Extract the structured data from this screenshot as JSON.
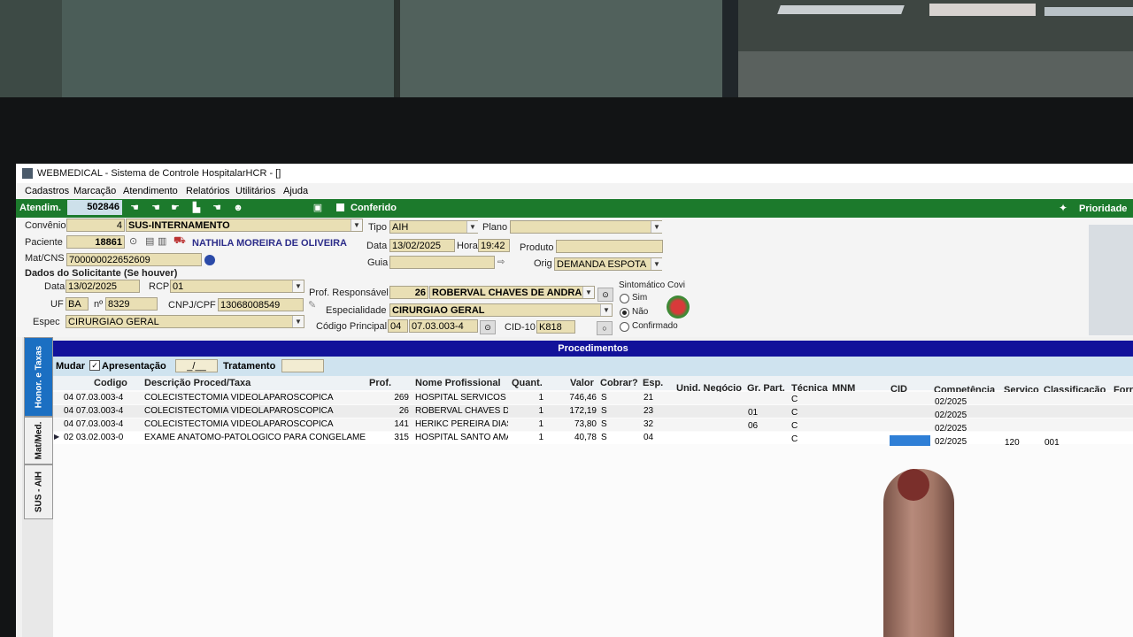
{
  "window": {
    "title": "WEBMEDICAL - Sistema de Controle HospitalarHCR - []"
  },
  "menu": [
    "Cadastros",
    "Marcação",
    "Atendimento",
    "Relatórios",
    "Utilitários",
    "Ajuda"
  ],
  "toolbar": {
    "atendimento_label": "Atendim.",
    "atendimento_value": "502846",
    "conferido_label": "Conferido",
    "prioridade_label": "Prioridade"
  },
  "form": {
    "convenio_label": "Convênio",
    "convenio_code": "4",
    "convenio_name": "SUS-INTERNAMENTO",
    "tipo_label": "Tipo",
    "tipo_value": "AIH",
    "plano_label": "Plano",
    "plano_value": "",
    "paciente_label": "Paciente",
    "paciente_code": "18861",
    "paciente_name": "NATHILA MOREIRA DE OLIVEIRA",
    "data_label": "Data",
    "data_value": "13/02/2025",
    "hora_label": "Hora",
    "hora_value": "19:42",
    "produto_label": "Produto",
    "produto_value": "",
    "matcns_label": "Mat/CNS",
    "matcns_value": "700000022652609",
    "guia_label": "Guia",
    "guia_value": "",
    "orig_label": "Orig",
    "orig_value": "DEMANDA ESPOTA",
    "solicitante_header": "Dados do Solicitante (Se houver)",
    "sol_data_label": "Data",
    "sol_data_value": "13/02/2025",
    "rcp_label": "RCP",
    "rcp_value": "01",
    "uf_label": "UF",
    "uf_value": "BA",
    "numero_label": "nº",
    "numero_value": "8329",
    "cnpj_label": "CNPJ/CPF",
    "cnpj_value": "13068008549",
    "espec_label": "Espec",
    "espec_value": "CIRURGIAO GERAL",
    "prof_resp_label": "Prof. Responsável",
    "prof_resp_code": "26",
    "prof_resp_name": "ROBERVAL CHAVES DE ANDRA",
    "especialidade_label": "Especialidade",
    "especialidade_value": "CIRURGIAO GERAL",
    "cod_principal_label": "Código Principal",
    "cod_principal_group": "04",
    "cod_principal_value": "07.03.003-4",
    "cid10_label": "CID-10",
    "cid10_value": "K818",
    "covid_label": "Sintomático Covi",
    "covid_options": [
      "Sim",
      "Não",
      "Confirmado"
    ],
    "covid_selected": "Não"
  },
  "procedimentos": {
    "title": "Procedimentos",
    "mudar_label": "Mudar",
    "apresentacao_label": "Apresentação",
    "apresentacao_value": "_/__",
    "tratamento_label": "Tratamento",
    "tratamento_value": "",
    "columns": [
      "Codigo",
      "Descrição Proced/Taxa",
      "Prof.",
      "Nome Profissional",
      "Quant.",
      "Valor",
      "Cobrar?",
      "Esp.",
      "Unid. Negócio",
      "Gr. Part.",
      "Técnica",
      "MNM",
      "CID",
      "Competência",
      "Serviço",
      "Classificação",
      "Forr"
    ],
    "rows": [
      {
        "codigo": "04 07.03.003-4",
        "descricao": "COLECISTECTOMIA VIDEOLAPAROSCOPICA",
        "prof": "269",
        "nome": "HOSPITAL SERVICOS",
        "quant": "1",
        "valor": "746,46",
        "cobrar": "S",
        "esp": "21",
        "unid": "",
        "grpart": "",
        "tecnica": "C",
        "mnm": "",
        "cid": "",
        "competencia": "02/2025",
        "servico": "",
        "classificacao": ""
      },
      {
        "codigo": "04 07.03.003-4",
        "descricao": "COLECISTECTOMIA VIDEOLAPAROSCOPICA",
        "prof": "26",
        "nome": "ROBERVAL CHAVES D",
        "quant": "1",
        "valor": "172,19",
        "cobrar": "S",
        "esp": "23",
        "unid": "",
        "grpart": "01",
        "tecnica": "C",
        "mnm": "",
        "cid": "",
        "competencia": "02/2025",
        "servico": "",
        "classificacao": ""
      },
      {
        "codigo": "04 07.03.003-4",
        "descricao": "COLECISTECTOMIA VIDEOLAPAROSCOPICA",
        "prof": "141",
        "nome": "HERIKC PEREIRA DIAS",
        "quant": "1",
        "valor": "73,80",
        "cobrar": "S",
        "esp": "32",
        "unid": "",
        "grpart": "06",
        "tecnica": "C",
        "mnm": "",
        "cid": "",
        "competencia": "02/2025",
        "servico": "",
        "classificacao": ""
      },
      {
        "codigo": "02 03.02.003-0",
        "descricao": "EXAME ANATOMO-PATOLOGICO PARA CONGELAMEN",
        "prof": "315",
        "nome": "HOSPITAL SANTO AMA",
        "quant": "1",
        "valor": "40,78",
        "cobrar": "S",
        "esp": "04",
        "unid": "",
        "grpart": "",
        "tecnica": "C",
        "mnm": "",
        "cid": "",
        "competencia": "02/2025",
        "servico": "120",
        "classificacao": "001"
      }
    ]
  },
  "side_tabs": [
    "Honor. e Taxas",
    "Mat/Med.",
    "SUS - AIH"
  ],
  "colors": {
    "toolbar_green": "#1c7a2c",
    "procedimentos_bar": "#12129a",
    "field_bg": "#e9dfb4",
    "active_tab": "#1b6fc2"
  }
}
